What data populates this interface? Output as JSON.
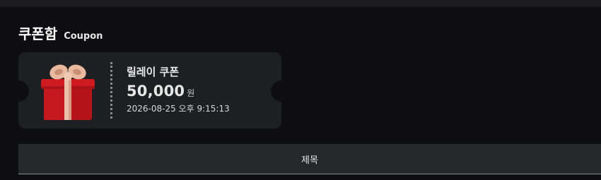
{
  "page": {
    "title": "쿠폰함",
    "subtitle": "Coupon"
  },
  "coupon": {
    "name": "릴레이 쿠폰",
    "amount": "50,000",
    "unit": "원",
    "expires": "2026-08-25 오후 9:15:13",
    "icon": "gift-icon"
  },
  "table": {
    "columns": [
      "제목"
    ]
  },
  "colors": {
    "background": "#0e0e10",
    "card": "#1e1f22",
    "header": "#25272a",
    "gift_box": "#c8161d",
    "ribbon": "#e9b9a2"
  }
}
